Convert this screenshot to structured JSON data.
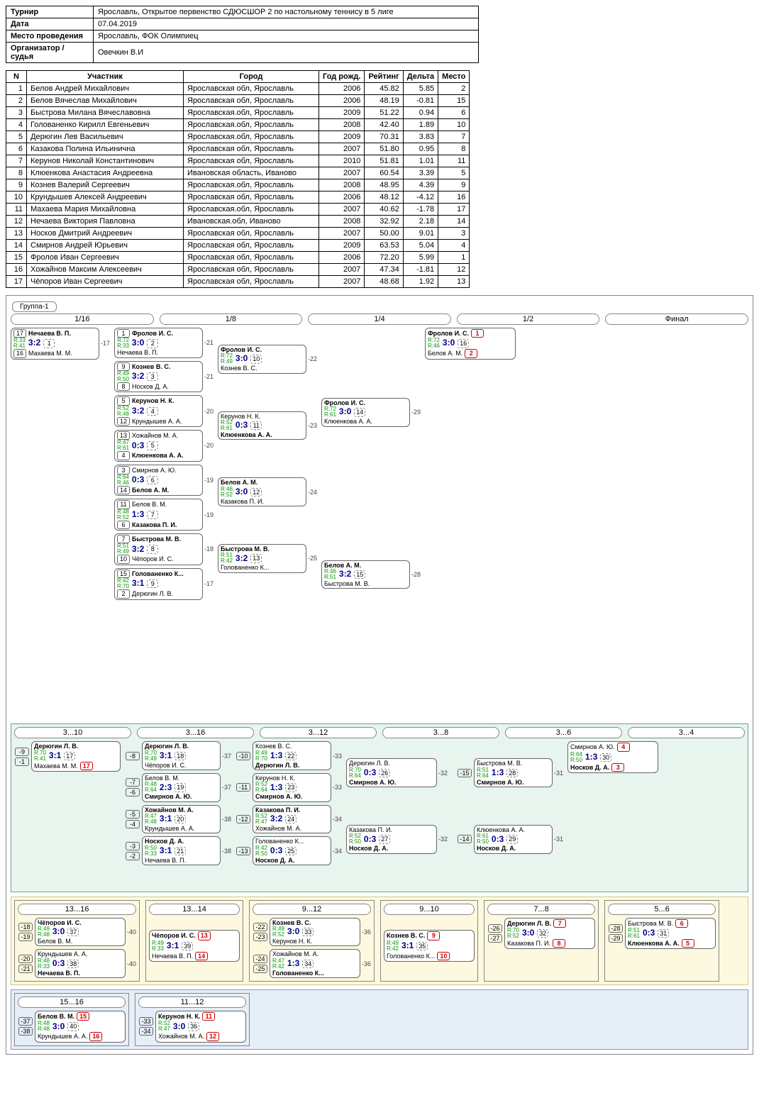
{
  "info": {
    "tournament_lbl": "Турнир",
    "tournament": "Ярославль, Открытое первенство СДЮСШОР 2 по настольному теннису в 5 лиге",
    "date_lbl": "Дата",
    "date": "07.04.2019",
    "venue_lbl": "Место проведения",
    "venue": "Ярославль, ФОК Олимпиец",
    "org_lbl": "Организатор / судья",
    "org": "Овечкин В.И"
  },
  "headers": {
    "n": "N",
    "name": "Участник",
    "city": "Город",
    "year": "Год рожд.",
    "rating": "Рейтинг",
    "delta": "Дельта",
    "place": "Место"
  },
  "players": [
    {
      "n": 1,
      "name": "Белов Андрей Михайлович",
      "city": "Ярославская обл, Ярославль",
      "year": 2006,
      "rating": "45.82",
      "delta": "5.85",
      "place": 2
    },
    {
      "n": 2,
      "name": "Белов Вячеслав Михайлович",
      "city": "Ярославская обл, Ярославль",
      "year": 2006,
      "rating": "48.19",
      "delta": "-0.81",
      "place": 15
    },
    {
      "n": 3,
      "name": "Быстрова Милана Вячеславовна",
      "city": "Ярославская.обл, Ярославль",
      "year": 2009,
      "rating": "51.22",
      "delta": "0.94",
      "place": 6
    },
    {
      "n": 4,
      "name": "Голованенко Кирилл Евгеньевич",
      "city": "Ярославская.обл, Ярославль",
      "year": 2008,
      "rating": "42.40",
      "delta": "1.89",
      "place": 10
    },
    {
      "n": 5,
      "name": "Дерюгин Лев Васильевич",
      "city": "Ярославская.обл, Ярославль",
      "year": 2009,
      "rating": "70.31",
      "delta": "3.83",
      "place": 7
    },
    {
      "n": 6,
      "name": "Казакова Полина Ильинична",
      "city": "Ярославская обл, Ярославль",
      "year": 2007,
      "rating": "51.80",
      "delta": "0.95",
      "place": 8
    },
    {
      "n": 7,
      "name": "Керунов Николай Константинович",
      "city": "Ярославская обл, Ярославль",
      "year": 2010,
      "rating": "51.81",
      "delta": "1.01",
      "place": 11
    },
    {
      "n": 8,
      "name": "Клюенкова Анастасия Андреевна",
      "city": "Ивановская область, Иваново",
      "year": 2007,
      "rating": "60.54",
      "delta": "3.39",
      "place": 5
    },
    {
      "n": 9,
      "name": "Кознев Валерий Сергеевич",
      "city": "Ярославская.обл, Ярославль",
      "year": 2008,
      "rating": "48.95",
      "delta": "4.39",
      "place": 9
    },
    {
      "n": 10,
      "name": "Крундышев Алексей Андреевич",
      "city": "Ярославская обл, Ярославль",
      "year": 2006,
      "rating": "48.12",
      "delta": "-4.12",
      "place": 16
    },
    {
      "n": 11,
      "name": "Махаева Мария Михайловна",
      "city": "Ярославская.обл, Ярославль",
      "year": 2007,
      "rating": "40.62",
      "delta": "-1.78",
      "place": 17
    },
    {
      "n": 12,
      "name": "Нечаева Виктория Павловна",
      "city": "Ивановская.обл, Иваново",
      "year": 2008,
      "rating": "32.92",
      "delta": "2.18",
      "place": 14
    },
    {
      "n": 13,
      "name": "Носков Дмитрий Андреевич",
      "city": "Ярославская обл, Ярославль",
      "year": 2007,
      "rating": "50.00",
      "delta": "9.01",
      "place": 3
    },
    {
      "n": 14,
      "name": "Смирнов Андрей Юрьевич",
      "city": "Ярославская обл, Ярославль",
      "year": 2009,
      "rating": "63.53",
      "delta": "5.04",
      "place": 4
    },
    {
      "n": 15,
      "name": "Фролов Иван Сергеевич",
      "city": "Ярославская обл, Ярославль",
      "year": 2006,
      "rating": "72.20",
      "delta": "5.99",
      "place": 1
    },
    {
      "n": 16,
      "name": "Хожайнов Максим Алексеевич",
      "city": "Ярославская обл, Ярославль",
      "year": 2007,
      "rating": "47.34",
      "delta": "-1.81",
      "place": 12
    },
    {
      "n": 17,
      "name": "Чёпоров Иван Сергеевич",
      "city": "Ярославская обл, Ярославль",
      "year": 2007,
      "rating": "48.68",
      "delta": "1.92",
      "place": 13
    }
  ],
  "group": "Группа-1",
  "rounds": [
    "1/16",
    "1/8",
    "1/4",
    "1/2",
    "Финал"
  ],
  "r16": [
    {
      "s1": "17",
      "p1": "Нечаева В. П.",
      "r1": "R:33",
      "s2": "16",
      "p2": "Махаева М. М.",
      "r2": "R:41",
      "sc": "3:2",
      "g": "1",
      "lk": "-17"
    }
  ],
  "r8": [
    {
      "s1": "1",
      "p1": "Фролов И. С.",
      "r1": "R:72",
      "s2": "",
      "p2": "Нечаева В. П.",
      "r2": "R:33",
      "sc": "3:0",
      "g": "2",
      "lk": "-21"
    },
    {
      "s1": "9",
      "p1": "Кознев В. С.",
      "r1": "R:49",
      "s2": "8",
      "p2": "Носков Д. А.",
      "r2": "R:50",
      "sc": "3:2",
      "g": "3",
      "lk": "-21"
    },
    {
      "s1": "5",
      "p1": "Керунов Н. К.",
      "r1": "R:52",
      "s2": "12",
      "p2": "Крундышев А. А.",
      "r2": "R:48",
      "sc": "3:2",
      "g": "4",
      "lk": "-20"
    },
    {
      "s1": "13",
      "p1": "Хожайнов М. А.",
      "r1": "R:47",
      "s2": "4",
      "p2": "Клюенкова А. А.",
      "r2": "R:61",
      "sc": "0:3",
      "g": "5",
      "lk": "-20",
      "w": 2
    },
    {
      "s1": "3",
      "p1": "Смирнов А. Ю.",
      "r1": "R:64",
      "s2": "14",
      "p2": "Белов А. М.",
      "r2": "R:46",
      "sc": "0:3",
      "g": "6",
      "lk": "-19",
      "w": 2
    },
    {
      "s1": "11",
      "p1": "Белов В. М.",
      "r1": "R:48",
      "s2": "6",
      "p2": "Казакова П. И.",
      "r2": "R:52",
      "sc": "1:3",
      "g": "7",
      "lk": "-19",
      "w": 2
    },
    {
      "s1": "7",
      "p1": "Быстрова М. В.",
      "r1": "R:51",
      "s2": "10",
      "p2": "Чёпоров И. С.",
      "r2": "R:49",
      "sc": "3:2",
      "g": "8",
      "lk": "-18"
    },
    {
      "s1": "15",
      "p1": "Голованенко К...",
      "r1": "R:42",
      "s2": "2",
      "p2": "Дерюгин Л. В.",
      "r2": "R:70",
      "sc": "3:1",
      "g": "9",
      "lk": "-17"
    }
  ],
  "r4": [
    {
      "p1": "Фролов И. С.",
      "r1": "R:72",
      "p2": "Кознев В. С.",
      "r2": "R:49",
      "sc": "3:0",
      "g": "10",
      "lk": "-22"
    },
    {
      "p1": "Керунов Н. К.",
      "r1": "R:52",
      "p2": "Клюенкова А. А.",
      "r2": "R:61",
      "sc": "0:3",
      "g": "11",
      "lk": "-23",
      "w": 2
    },
    {
      "p1": "Белов А. М.",
      "r1": "R:46",
      "p2": "Казакова П. И.",
      "r2": "R:52",
      "sc": "3:0",
      "g": "12",
      "lk": "-24"
    },
    {
      "p1": "Быстрова М. В.",
      "r1": "R:51",
      "p2": "Голованенко К...",
      "r2": "R:42",
      "sc": "3:2",
      "g": "13",
      "lk": "-25"
    }
  ],
  "r2": [
    {
      "p1": "Фролов И. С.",
      "r1": "R:72",
      "p2": "Клюенкова А. А.",
      "r2": "R:61",
      "sc": "3:0",
      "g": "14",
      "lk": "-29"
    },
    {
      "p1": "Белов А. М.",
      "r1": "R:46",
      "p2": "Быстрова М. В.",
      "r2": "R:51",
      "sc": "3:2",
      "g": "15",
      "lk": "-28"
    }
  ],
  "final": {
    "p1": "Фролов И. С.",
    "r1": "R:72",
    "p2": "Белов А. М.",
    "r2": "R:46",
    "sc": "3:0",
    "g": "16",
    "pl1": "1",
    "pl2": "2"
  },
  "cons_hdrs": [
    "3...10",
    "3...16",
    "3...12",
    "3...8",
    "3...6",
    "3...4"
  ],
  "c10": [
    {
      "e1": "-9",
      "p1": "Дерюгин Л. В.",
      "r1": "R:70",
      "e2": "-1",
      "p2": "Махаева М. М.",
      "r2": "R:41",
      "sc": "3:1",
      "g": "17",
      "pl": "17"
    }
  ],
  "c16": [
    {
      "e1": "",
      "p1": "Дерюгин Л. В.",
      "r1": "R:70",
      "e2": "-8",
      "p2": "Чёпоров И. С.",
      "r2": "R:49",
      "sc": "3:1",
      "g": "18",
      "lk": "-37"
    },
    {
      "e1": "-7",
      "p1": "Белов В. М.",
      "r1": "R:48",
      "e2": "-6",
      "p2": "Смирнов А. Ю.",
      "r2": "R:64",
      "sc": "2:3",
      "g": "19",
      "lk": "-37",
      "w": 2
    },
    {
      "e1": "-5",
      "p1": "Хожайнов М. А.",
      "r1": "R:47",
      "e2": "-4",
      "p2": "Крундышев А. А.",
      "r2": "R:48",
      "sc": "3:1",
      "g": "20",
      "lk": "-38"
    },
    {
      "e1": "-3",
      "p1": "Носков Д. А.",
      "r1": "R:50",
      "e2": "-2",
      "p2": "Нечаева В. П.",
      "r2": "R:33",
      "sc": "3:1",
      "g": "21",
      "lk": "-38"
    }
  ],
  "c12": [
    {
      "e1": "-10",
      "p1": "Кознев В. С.",
      "r1": "R:49",
      "p2": "Дерюгин Л. В.",
      "r2": "R:70",
      "sc": "1:3",
      "g": "22",
      "lk": "-33",
      "w": 2
    },
    {
      "e1": "-11",
      "p1": "Керунов Н. К.",
      "r1": "R:52",
      "p2": "Смирнов А. Ю.",
      "r2": "R:64",
      "sc": "1:3",
      "g": "23",
      "lk": "-33",
      "w": 2
    },
    {
      "e1": "-12",
      "p1": "Казакова П. И.",
      "r1": "R:52",
      "p2": "Хожайнов М. А.",
      "r2": "R:47",
      "sc": "3:2",
      "g": "24",
      "lk": "-34"
    },
    {
      "e1": "-13",
      "p1": "Голованенко К...",
      "r1": "R:42",
      "p2": "Носков Д. А.",
      "r2": "R:50",
      "sc": "0:3",
      "g": "25",
      "lk": "-34",
      "w": 2
    }
  ],
  "c8": [
    {
      "p1": "Дерюгин Л. В.",
      "r1": "R:70",
      "p2": "Смирнов А. Ю.",
      "r2": "R:64",
      "sc": "0:3",
      "g": "26",
      "lk": "-32",
      "w": 2
    },
    {
      "p1": "Казакова П. И.",
      "r1": "R:52",
      "p2": "Носков Д. А.",
      "r2": "R:50",
      "sc": "0:3",
      "g": "27",
      "lk": "-32",
      "w": 2
    }
  ],
  "c6": [
    {
      "e1": "-15",
      "p1": "Быстрова М. В.",
      "r1": "R:51",
      "p2": "Смирнов А. Ю.",
      "r2": "R:64",
      "sc": "1:3",
      "g": "28",
      "lk": "-31",
      "w": 2
    },
    {
      "e1": "-14",
      "p1": "Клюенкова А. А.",
      "r1": "R:61",
      "p2": "Носков Д. А.",
      "r2": "R:50",
      "sc": "0:3",
      "g": "29",
      "lk": "-31",
      "w": 2
    }
  ],
  "c4": {
    "p1": "Смирнов А. Ю.",
    "r1": "R:64",
    "p2": "Носков Д. А.",
    "r2": "R:50",
    "sc": "1:3",
    "g": "30",
    "pl1": "4",
    "pl2": "3",
    "w": 2
  },
  "yel_hdrs": [
    "13...16",
    "13...14",
    "9...12",
    "9...10",
    "7...8",
    "5...6"
  ],
  "y1316": [
    {
      "e1": "-18",
      "p1": "Чёпоров И. С.",
      "r1": "R:49",
      "e2": "-19",
      "p2": "Белов В. М.",
      "r2": "R:48",
      "sc": "3:0",
      "g": "37",
      "lk": "-40"
    },
    {
      "e1": "-20",
      "p1": "Крундышев А. А.",
      "r1": "R:48",
      "e2": "-21",
      "p2": "Нечаева В. П.",
      "r2": "R:33",
      "sc": "0:3",
      "g": "38",
      "lk": "-40",
      "w": 2
    }
  ],
  "y1314": {
    "p1": "Чёпоров И. С.",
    "r1": "R:49",
    "p2": "Нечаева В. П.",
    "r2": "R:33",
    "sc": "3:1",
    "g": "39",
    "pl1": "13",
    "pl2": "14"
  },
  "y912": [
    {
      "e1": "-22",
      "p1": "Кознев В. С.",
      "r1": "R:49",
      "e2": "-23",
      "p2": "Керунов Н. К.",
      "r2": "R:52",
      "sc": "3:0",
      "g": "33",
      "lk": "-36"
    },
    {
      "e1": "-24",
      "p1": "Хожайнов М. А.",
      "r1": "R:47",
      "e2": "-25",
      "p2": "Голованенко К...",
      "r2": "R:42",
      "sc": "1:3",
      "g": "34",
      "lk": "-36",
      "w": 2
    }
  ],
  "y910": {
    "p1": "Кознев В. С.",
    "r1": "R:49",
    "p2": "Голованенко К...",
    "r2": "R:42",
    "sc": "3:1",
    "g": "35",
    "pl1": "9",
    "pl2": "10"
  },
  "y78": {
    "e1": "-26",
    "p1": "Дерюгин Л. В.",
    "r1": "R:70",
    "e2": "-27",
    "p2": "Казакова П. И.",
    "r2": "R:52",
    "sc": "3:0",
    "g": "32",
    "pl1": "7",
    "pl2": "8"
  },
  "y56": {
    "e1": "-28",
    "p1": "Быстрова М. В.",
    "r1": "R:51",
    "e2": "-29",
    "p2": "Клюенкова А. А.",
    "r2": "R:61",
    "sc": "0:3",
    "g": "31",
    "pl1": "6",
    "pl2": "5",
    "w": 2
  },
  "blu_hdrs": [
    "15...16",
    "11...12"
  ],
  "b1516": {
    "e1": "-37",
    "p1": "Белов В. М.",
    "r1": "R:48",
    "e2": "-38",
    "p2": "Крундышев А. А.",
    "r2": "R:48",
    "sc": "3:0",
    "g": "40",
    "pl1": "15",
    "pl2": "16"
  },
  "b1112": {
    "e1": "-33",
    "p1": "Керунов Н. К.",
    "r1": "R:52",
    "e2": "-34",
    "p2": "Хожайнов М. А.",
    "r2": "R:47",
    "sc": "3:0",
    "g": "36",
    "pl1": "11",
    "pl2": "12"
  }
}
